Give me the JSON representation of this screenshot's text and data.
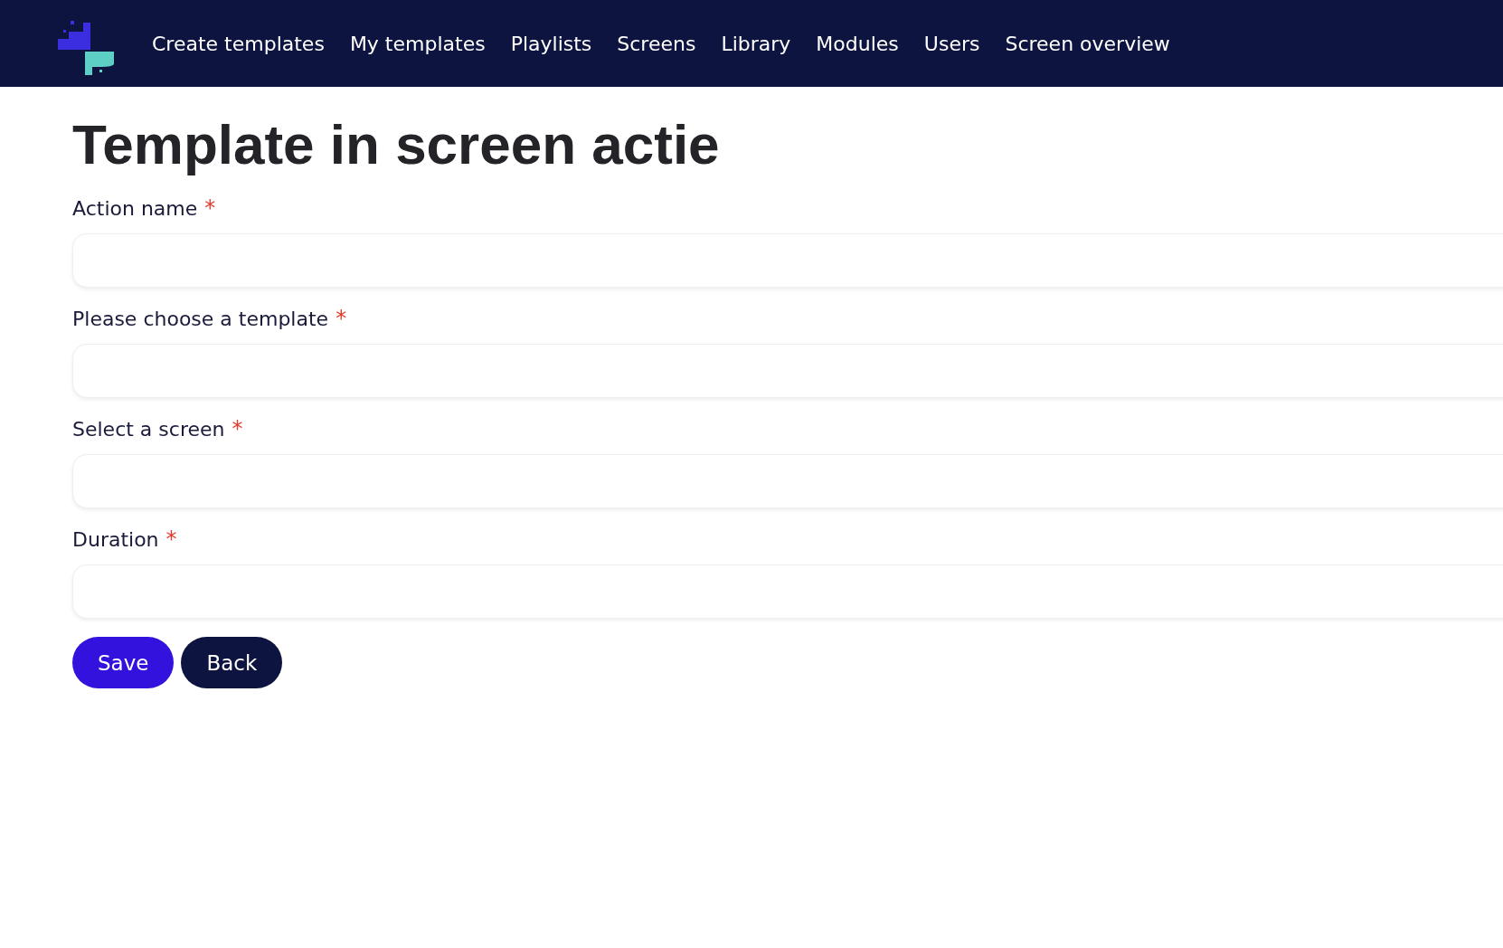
{
  "nav": {
    "items": [
      {
        "label": "Create templates"
      },
      {
        "label": "My templates"
      },
      {
        "label": "Playlists"
      },
      {
        "label": "Screens"
      },
      {
        "label": "Library"
      },
      {
        "label": "Modules"
      },
      {
        "label": "Users"
      },
      {
        "label": "Screen overview"
      }
    ]
  },
  "title": "Template in screen actie",
  "fields": [
    {
      "label": "Action name",
      "required_mark": "*"
    },
    {
      "label": "Please choose a template",
      "required_mark": "*"
    },
    {
      "label": "Select a screen",
      "required_mark": "*"
    },
    {
      "label": "Duration",
      "required_mark": "*"
    }
  ],
  "buttons": [
    {
      "label": "Save",
      "kind": "primary"
    },
    {
      "label": "Back",
      "kind": "secondary"
    }
  ]
}
